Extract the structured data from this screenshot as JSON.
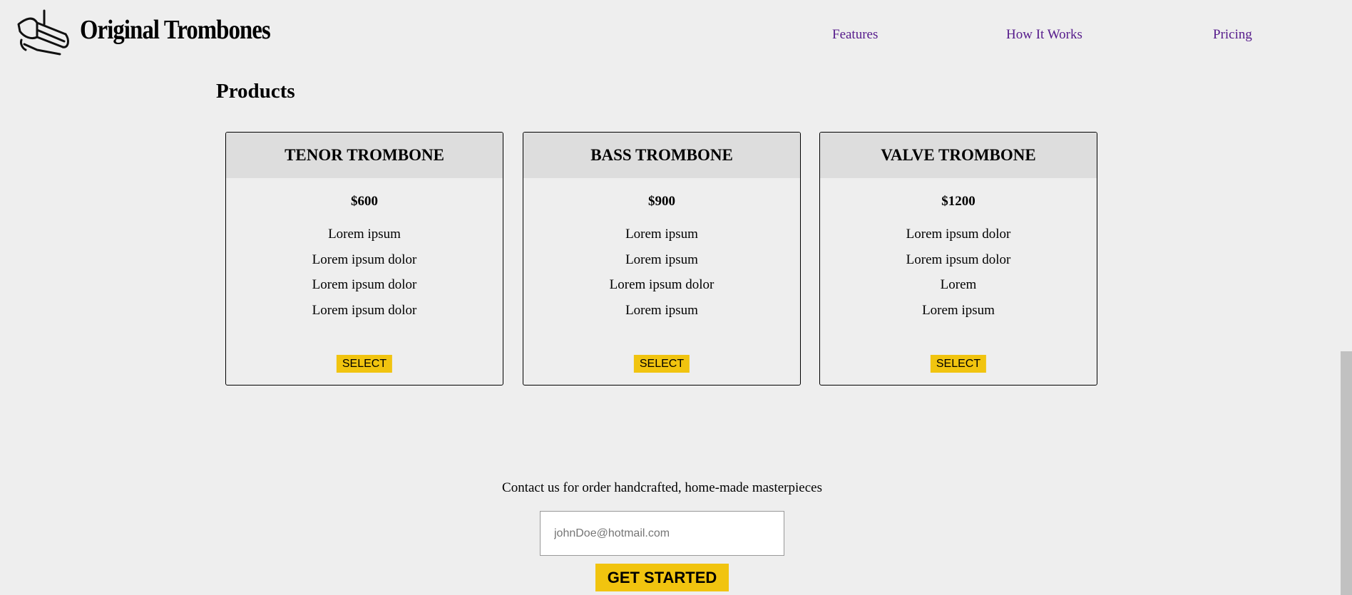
{
  "header": {
    "brand": "Original Trombones",
    "logo_icon": "trombone-icon",
    "nav": {
      "features": "Features",
      "how_it_works": "How It Works",
      "pricing": "Pricing"
    }
  },
  "products": {
    "title": "Products",
    "cards": [
      {
        "name": "TENOR TROMBONE",
        "price": "$600",
        "features": [
          "Lorem ipsum",
          "Lorem ipsum dolor",
          "Lorem ipsum dolor",
          "Lorem ipsum dolor"
        ],
        "button": "SELECT"
      },
      {
        "name": "BASS TROMBONE",
        "price": "$900",
        "features": [
          "Lorem ipsum",
          "Lorem ipsum",
          "Lorem ipsum dolor",
          "Lorem ipsum"
        ],
        "button": "SELECT"
      },
      {
        "name": "VALVE TROMBONE",
        "price": "$1200",
        "features": [
          "Lorem ipsum dolor",
          "Lorem ipsum dolor",
          "Lorem",
          "Lorem ipsum"
        ],
        "button": "SELECT"
      }
    ]
  },
  "contact": {
    "text": "Contact us for order handcrafted, home-made masterpieces",
    "email_placeholder": "johnDoe@hotmail.com",
    "email_value": "",
    "cta": "GET STARTED"
  },
  "colors": {
    "background": "#eeeeee",
    "accent": "#f1c40f",
    "nav_link": "#551a8b",
    "card_header": "#dddddd"
  }
}
